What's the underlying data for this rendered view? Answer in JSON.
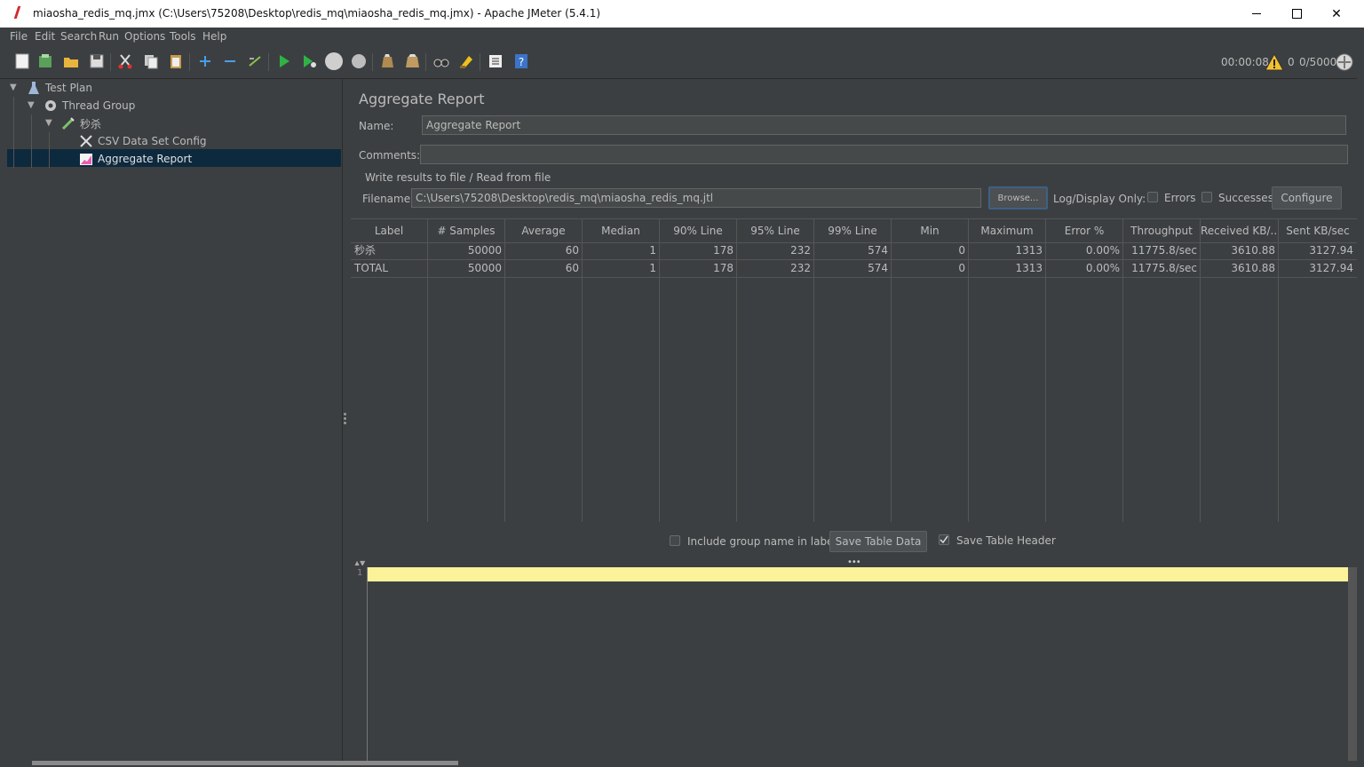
{
  "window": {
    "title": "miaosha_redis_mq.jmx (C:\\Users\\75208\\Desktop\\redis_mq\\miaosha_redis_mq.jmx) - Apache JMeter (5.4.1)",
    "minimize": "—",
    "maximize": "□",
    "close": "✕"
  },
  "menu": [
    "File",
    "Edit",
    "Search",
    "Run",
    "Options",
    "Tools",
    "Help"
  ],
  "toolbar": {
    "timer": "00:00:08",
    "warnings": "0",
    "threads": "0/5000",
    "buttons": [
      "new-icon",
      "templates-icon",
      "open-icon",
      "save-icon",
      "cut-icon",
      "copy-icon",
      "paste-icon",
      "expand-icon",
      "collapse-icon",
      "toggle-icon",
      "start-icon",
      "start-no-pause-icon",
      "stop-icon",
      "shutdown-icon",
      "clear-icon",
      "clear-all-icon",
      "search-icon",
      "reset-search-icon",
      "function-helper-icon",
      "help-icon"
    ]
  },
  "tree": {
    "nodes": [
      {
        "label": "Test Plan",
        "icon": "flask-icon"
      },
      {
        "label": "Thread Group",
        "icon": "gear-icon"
      },
      {
        "label": "秒杀",
        "icon": "dropper-icon"
      },
      {
        "label": "CSV Data Set Config",
        "icon": "wrench-icon"
      },
      {
        "label": "Aggregate Report",
        "icon": "chart-icon"
      }
    ],
    "selected": 4
  },
  "panel": {
    "title": "Aggregate Report",
    "name_label": "Name:",
    "name_value": "Aggregate Report",
    "comments_label": "Comments:",
    "comments_value": "",
    "file_section": "Write results to file / Read from file",
    "filename_label": "Filename",
    "filename_value": "C:\\Users\\75208\\Desktop\\redis_mq\\miaosha_redis_mq.jtl",
    "browse": "Browse...",
    "log_display": "Log/Display Only:",
    "errors": "Errors",
    "successes": "Successes",
    "configure": "Configure"
  },
  "table": {
    "headers": [
      "Label",
      "# Samples",
      "Average",
      "Median",
      "90% Line",
      "95% Line",
      "99% Line",
      "Min",
      "Maximum",
      "Error %",
      "Throughput",
      "Received KB/...",
      "Sent KB/sec"
    ],
    "rows": [
      [
        "秒杀",
        "50000",
        "60",
        "1",
        "178",
        "232",
        "574",
        "0",
        "1313",
        "0.00%",
        "11775.8/sec",
        "3610.88",
        "3127.94"
      ],
      [
        "TOTAL",
        "50000",
        "60",
        "1",
        "178",
        "232",
        "574",
        "0",
        "1313",
        "0.00%",
        "11775.8/sec",
        "3610.88",
        "3127.94"
      ]
    ]
  },
  "footer": {
    "include_group": "Include group name in label?",
    "save_table_data": "Save Table Data",
    "save_table_header": "Save Table Header",
    "save_header_checked": true
  },
  "editor": {
    "line_number": "1"
  }
}
